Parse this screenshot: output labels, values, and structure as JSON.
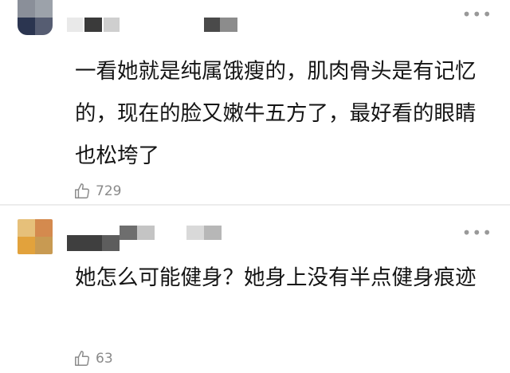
{
  "comments": [
    {
      "more_label": "•••",
      "text": "一看她就是纯属饿瘦的，肌肉骨头是有记忆的，现在的脸又嫩牛五方了，最好看的眼睛也松垮了",
      "likes": "729",
      "avatar_icon": "blurred-avatar",
      "like_icon": "thumbs-up-icon"
    },
    {
      "more_label": "•••",
      "text": "她怎么可能健身？她身上没有半点健身痕迹",
      "likes": "63",
      "avatar_icon": "blurred-avatar",
      "like_icon": "thumbs-up-icon"
    }
  ],
  "colors": {
    "text": "#151515",
    "meta": "#8a8a8a",
    "divider": "#ececec"
  }
}
